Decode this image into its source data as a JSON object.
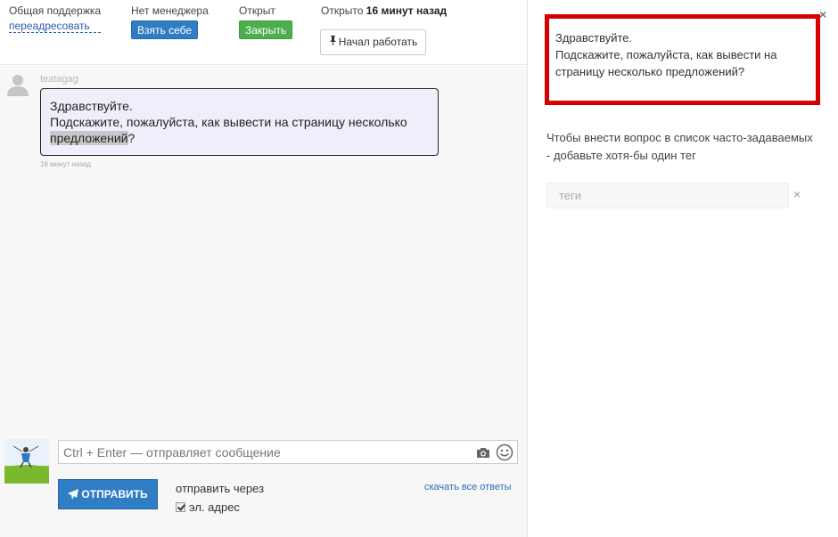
{
  "topbar": {
    "support": {
      "label": "Общая поддержка",
      "link": "переадресовать"
    },
    "manager": {
      "label": "Нет менеджера",
      "button": "Взять себе"
    },
    "status": {
      "label": "Открыт",
      "button": "Закрыть"
    },
    "opened": {
      "prefix": "Открыто",
      "time": "16 минут назад"
    },
    "start_work_label": "Начал работать"
  },
  "message": {
    "author": "teatagag",
    "line1": "Здравствуйте.",
    "line2_start": "Подскажите, пожалуйста, как вывести на страницу несколько",
    "line2_highlight": "предложений",
    "line2_end": "?",
    "time": "16 минут назад"
  },
  "composer": {
    "placeholder": "Ctrl + Enter — отправляет сообщение",
    "send_label": "ОТПРАВИТЬ",
    "send_via": "отправить через",
    "email_option": "эл. адрес",
    "download_link": "скачать все ответы"
  },
  "sidebar": {
    "close": "×",
    "question_line1": "Здравствуйте.",
    "question_line2": "Подскажите, пожалуйста, как вывести на страницу несколько предложений?",
    "faq_note": "Чтобы внести вопрос в список часто-задаваемых - добавьте хотя-бы один тег",
    "tags_placeholder": "теги",
    "tags_clear": "×"
  },
  "colors": {
    "primary": "#2f7dc4",
    "success": "#4cae4c",
    "highlight_border": "#d50000",
    "bubble_bg": "#efeffc"
  },
  "icons": [
    "pin-icon",
    "user-placeholder-icon",
    "camera-icon",
    "smile-icon",
    "paper-plane-icon",
    "close-icon",
    "checkbox-check-icon"
  ]
}
